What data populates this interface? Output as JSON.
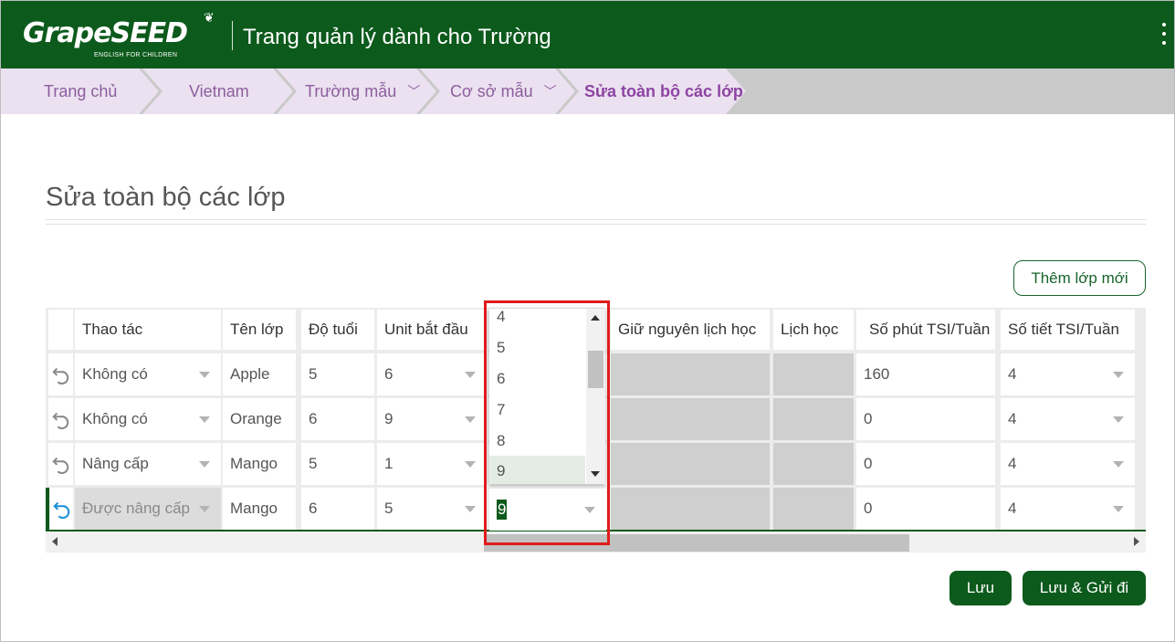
{
  "header": {
    "logo_text": "GrapeSEED",
    "logo_sub": "ENGLISH FOR CHILDREN",
    "title": "Trang quản lý dành cho Trường"
  },
  "breadcrumb": [
    {
      "label": "Trang chủ",
      "dropdown": false
    },
    {
      "label": "Vietnam",
      "dropdown": false
    },
    {
      "label": "Trường mẫu",
      "dropdown": true
    },
    {
      "label": "Cơ sở mẫu",
      "dropdown": true
    },
    {
      "label": "Sửa toàn bộ các lớp",
      "dropdown": false,
      "active": true
    }
  ],
  "page": {
    "title": "Sửa toàn bộ các lớp",
    "add_button": "Thêm lớp mới"
  },
  "grid": {
    "columns": [
      "Thao tác",
      "Tên lớp",
      "Độ tuổi",
      "Unit bắt đầu",
      "",
      "Giữ nguyên lịch học",
      "Lịch học",
      "Số phút TSI/Tuần",
      "Số tiết TSI/Tuần"
    ],
    "rows": [
      {
        "action": "Không có",
        "name": "Apple",
        "age": "5",
        "unit_start": "6",
        "tsi_minutes": "160",
        "tsi_lessons": "4"
      },
      {
        "action": "Không có",
        "name": "Orange",
        "age": "6",
        "unit_start": "9",
        "tsi_minutes": "0",
        "tsi_lessons": "4"
      },
      {
        "action": "Nâng cấp",
        "name": "Mango",
        "age": "5",
        "unit_start": "1",
        "tsi_minutes": "0",
        "tsi_lessons": "4"
      },
      {
        "action": "Được nâng cấp",
        "name": "Mango",
        "age": "6",
        "unit_start": "5",
        "editing_value": "9",
        "tsi_minutes": "0",
        "tsi_lessons": "4"
      }
    ]
  },
  "dropdown": {
    "options": [
      "4",
      "5",
      "6",
      "7",
      "8",
      "9"
    ],
    "selected": "9"
  },
  "footer": {
    "save": "Lưu",
    "save_send": "Lưu & Gửi đi"
  },
  "colors": {
    "brand_green": "#0c5a1c",
    "breadcrumb_bg": "#ebe1f0",
    "breadcrumb_text": "#8d5d9e",
    "highlight_red": "#e21b1b"
  }
}
